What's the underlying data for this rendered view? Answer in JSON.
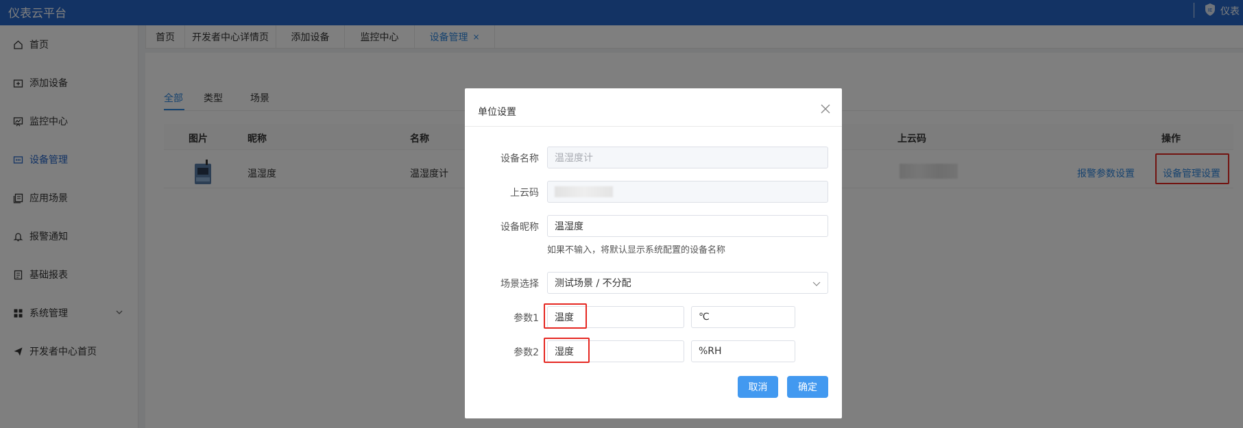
{
  "app": {
    "title": "仪表云平台",
    "user_label": "仪表"
  },
  "sidebar": {
    "items": [
      {
        "label": "首页",
        "icon": "home-icon"
      },
      {
        "label": "添加设备",
        "icon": "add-device-icon"
      },
      {
        "label": "监控中心",
        "icon": "monitor-icon"
      },
      {
        "label": "设备管理",
        "icon": "device-manage-icon",
        "active": true
      },
      {
        "label": "应用场景",
        "icon": "scene-icon"
      },
      {
        "label": "报警通知",
        "icon": "bell-icon"
      },
      {
        "label": "基础报表",
        "icon": "report-icon"
      },
      {
        "label": "系统管理",
        "icon": "grid-icon",
        "expandable": true
      },
      {
        "label": "开发者中心首页",
        "icon": "send-icon"
      }
    ]
  },
  "tabs": [
    {
      "label": "首页"
    },
    {
      "label": "开发者中心详情页"
    },
    {
      "label": "添加设备"
    },
    {
      "label": "监控中心"
    },
    {
      "label": "设备管理",
      "active": true,
      "close": "×"
    }
  ],
  "subtabs": [
    {
      "label": "全部",
      "active": true
    },
    {
      "label": "类型"
    },
    {
      "label": "场景"
    }
  ],
  "table": {
    "columns": [
      "图片",
      "昵称",
      "名称",
      "上云码",
      "操作"
    ],
    "rows": [
      {
        "nickname": "温湿度",
        "name": "温湿度计",
        "actions": [
          "报警参数设置",
          "设备管理设置"
        ]
      }
    ]
  },
  "modal": {
    "title": "单位设置",
    "fields": {
      "device_name": {
        "label": "设备名称",
        "value": "温湿度计"
      },
      "cloud_code": {
        "label": "上云码"
      },
      "nickname": {
        "label": "设备昵称",
        "value": "温湿度",
        "hint": "如果不输入，将默认显示系统配置的设备名称"
      },
      "scene": {
        "label": "场景选择",
        "value": "测试场景 / 不分配"
      },
      "param1": {
        "label": "参数1",
        "name": "温度",
        "unit": "℃"
      },
      "param2": {
        "label": "参数2",
        "name": "湿度",
        "unit": "%RH"
      }
    },
    "cancel_label": "取消",
    "confirm_label": "确定"
  },
  "colors": {
    "header": "#2667c8",
    "accent": "#2e86de",
    "highlight": "#e52620",
    "button": "#4299f0"
  }
}
